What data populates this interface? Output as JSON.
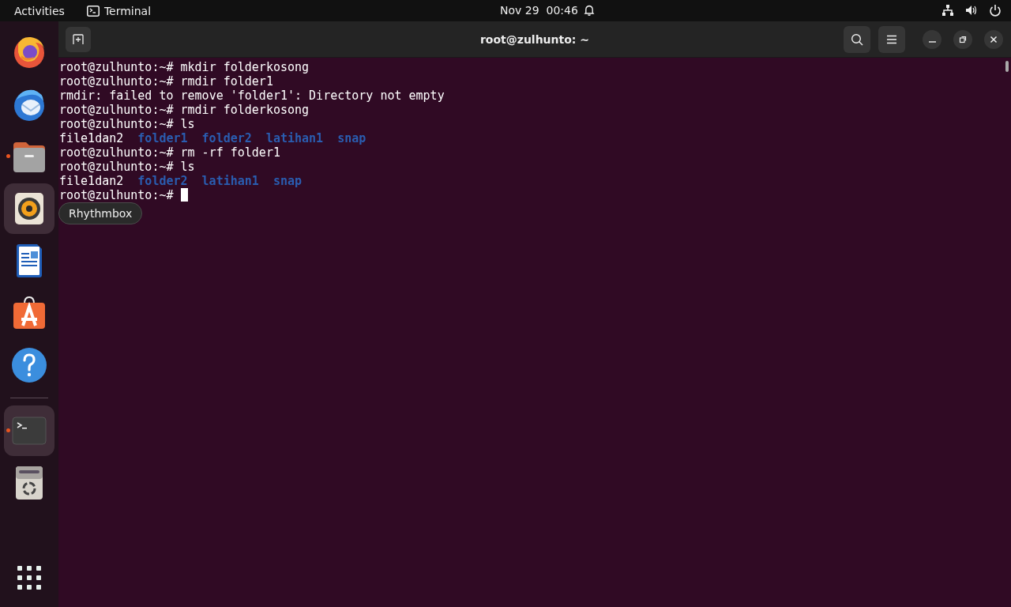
{
  "top_bar": {
    "activities": "Activities",
    "app_menu": "Terminal",
    "clock": "Nov 29  00:46"
  },
  "dock": {
    "favorites": [
      {
        "kind": "browser",
        "running": false,
        "highlighted": false
      },
      {
        "kind": "mail",
        "running": false,
        "highlighted": false
      },
      {
        "kind": "files",
        "running": true,
        "highlighted": false
      },
      {
        "kind": "music",
        "running": false,
        "highlighted": true
      },
      {
        "kind": "writer",
        "running": false,
        "highlighted": false
      },
      {
        "kind": "software",
        "running": false,
        "highlighted": false
      },
      {
        "kind": "help",
        "running": false,
        "highlighted": false
      }
    ],
    "others": [
      {
        "kind": "terminal",
        "running": true,
        "highlighted": true
      },
      {
        "kind": "trash",
        "running": false,
        "highlighted": false
      }
    ]
  },
  "tooltip": "Rhythmbox",
  "window": {
    "title": "root@zulhunto: ~",
    "lines": [
      {
        "kind": "text",
        "text": "root@zulhunto:~# mkdir folderkosong"
      },
      {
        "kind": "text",
        "text": "root@zulhunto:~# rmdir folder1"
      },
      {
        "kind": "text",
        "text": "rmdir: failed to remove 'folder1': Directory not empty"
      },
      {
        "kind": "text",
        "text": "root@zulhunto:~# rmdir folderkosong"
      },
      {
        "kind": "text",
        "text": "root@zulhunto:~# ls"
      },
      {
        "kind": "listing",
        "entries": [
          {
            "name": "file1dan2",
            "directory": false
          },
          {
            "name": "folder1",
            "directory": true
          },
          {
            "name": "folder2",
            "directory": true
          },
          {
            "name": "latihan1",
            "directory": true
          },
          {
            "name": "snap",
            "directory": true
          }
        ]
      },
      {
        "kind": "text",
        "text": "root@zulhunto:~# rm -rf folder1"
      },
      {
        "kind": "text",
        "text": "root@zulhunto:~# ls"
      },
      {
        "kind": "listing",
        "entries": [
          {
            "name": "file1dan2",
            "directory": false
          },
          {
            "name": "folder2",
            "directory": true
          },
          {
            "name": "latihan1",
            "directory": true
          },
          {
            "name": "snap",
            "directory": true
          }
        ]
      },
      {
        "kind": "text",
        "text": "root@zulhunto:~#",
        "cursor": true
      }
    ]
  }
}
